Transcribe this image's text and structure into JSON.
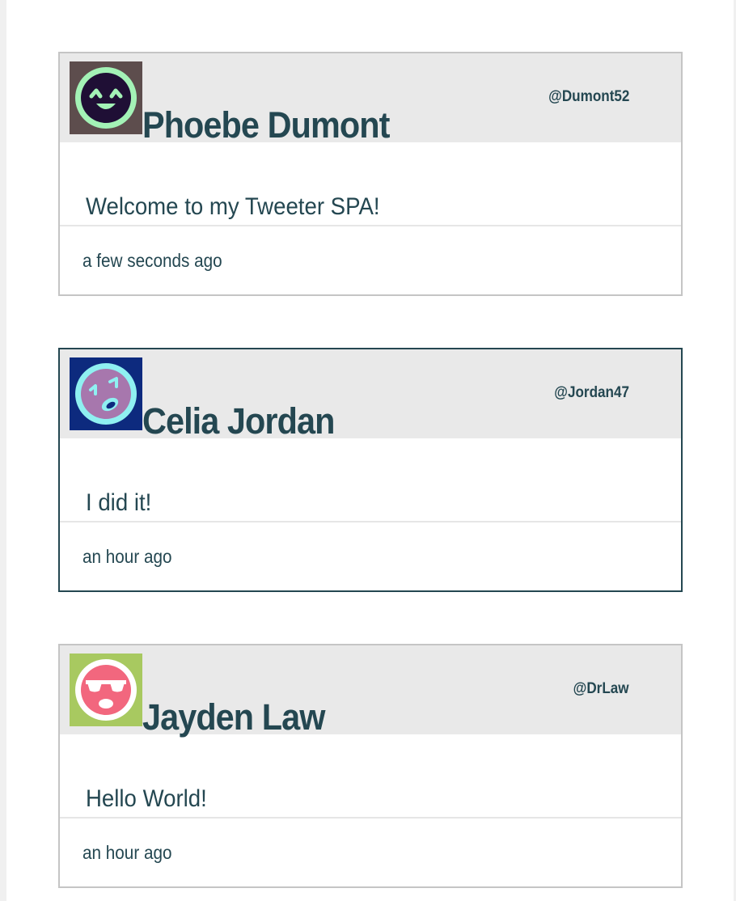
{
  "theme": {
    "text_color": "#244751",
    "header_bg": "#e9e9e9",
    "border_color": "#c5c5c5",
    "hover_border_color": "#244751"
  },
  "tweets": [
    {
      "avatar": {
        "icon": "smiling-face-icon",
        "bg": "#5d4d4d",
        "face": "#1f0f35",
        "ring": "#a3f2b6"
      },
      "display_name": "Phoebe Dumont",
      "handle": "@Dumont52",
      "text": "Welcome to my Tweeter SPA!",
      "timestamp": "a few seconds ago"
    },
    {
      "avatar": {
        "icon": "crying-face-icon",
        "bg": "#0d2a7e",
        "face": "#a777ad",
        "ring": "#8ff0f1"
      },
      "display_name": "Celia Jordan",
      "handle": "@Jordan47",
      "text": "I did it!",
      "timestamp": "an hour ago"
    },
    {
      "avatar": {
        "icon": "sunglasses-face-icon",
        "bg": "#a8c960",
        "face": "#f2677e",
        "ring": "#ffffff"
      },
      "display_name": "Jayden Law",
      "handle": "@DrLaw",
      "text": "Hello World!",
      "timestamp": "an hour ago"
    }
  ]
}
